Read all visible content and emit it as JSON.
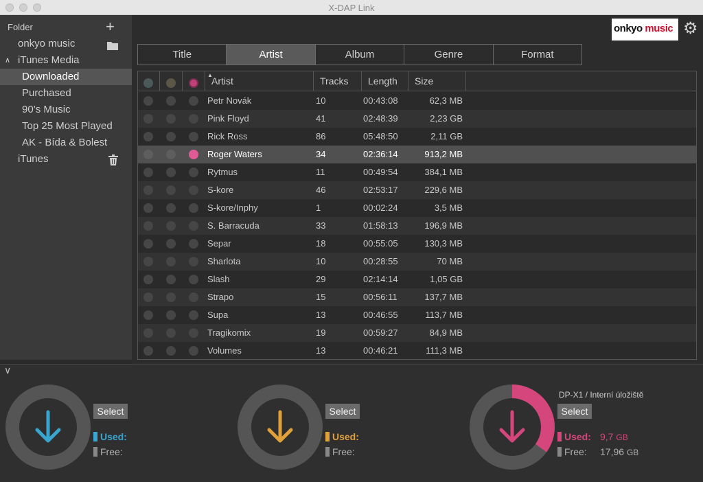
{
  "window": {
    "title": "X-DAP Link"
  },
  "sidebar": {
    "header": "Folder",
    "items": [
      {
        "label": "onkyo music",
        "icon": "folder-icon"
      },
      {
        "label": "iTunes Media"
      },
      {
        "label": "Downloaded",
        "selected": true
      },
      {
        "label": "Purchased"
      },
      {
        "label": "90’s Music"
      },
      {
        "label": "Top 25 Most Played"
      },
      {
        "label": "AK - Bída & Bolest"
      },
      {
        "label": "iTunes",
        "icon": "trash-icon"
      }
    ]
  },
  "logo": {
    "part1": "onkyo",
    "part2": "music"
  },
  "tabs": [
    "Title",
    "Artist",
    "Album",
    "Genre",
    "Format"
  ],
  "active_tab": "Artist",
  "table": {
    "columns": [
      "Artist",
      "Tracks",
      "Length",
      "Size"
    ],
    "header_dot_colors": [
      "#4b5a58",
      "#5c5647",
      "#c0417a"
    ],
    "rows": [
      {
        "artist": "Petr Novák",
        "tracks": "10",
        "length": "00:43:08",
        "size": "62,3 MB"
      },
      {
        "artist": "Pink Floyd",
        "tracks": "41",
        "length": "02:48:39",
        "size": "2,23 GB"
      },
      {
        "artist": "Rick Ross",
        "tracks": "86",
        "length": "05:48:50",
        "size": "2,11 GB"
      },
      {
        "artist": "Roger Waters",
        "tracks": "34",
        "length": "02:36:14",
        "size": "913,2 MB",
        "selected": true
      },
      {
        "artist": "Rytmus",
        "tracks": "11",
        "length": "00:49:54",
        "size": "384,1 MB"
      },
      {
        "artist": "S-kore",
        "tracks": "46",
        "length": "02:53:17",
        "size": "229,6 MB"
      },
      {
        "artist": "S-kore/Inphy",
        "tracks": "1",
        "length": "00:02:24",
        "size": "3,5 MB"
      },
      {
        "artist": "S. Barracuda",
        "tracks": "33",
        "length": "01:58:13",
        "size": "196,9 MB"
      },
      {
        "artist": "Separ",
        "tracks": "18",
        "length": "00:55:05",
        "size": "130,3 MB"
      },
      {
        "artist": "Sharlota",
        "tracks": "10",
        "length": "00:28:55",
        "size": "70 MB"
      },
      {
        "artist": "Slash",
        "tracks": "29",
        "length": "02:14:14",
        "size": "1,05 GB"
      },
      {
        "artist": "Strapo",
        "tracks": "15",
        "length": "00:56:11",
        "size": "137,7 MB"
      },
      {
        "artist": "Supa",
        "tracks": "13",
        "length": "00:46:55",
        "size": "113,7 MB"
      },
      {
        "artist": "Tragikomix",
        "tracks": "19",
        "length": "00:59:27",
        "size": "84,9 MB"
      },
      {
        "artist": "Volumes",
        "tracks": "13",
        "length": "00:46:21",
        "size": "111,3 MB"
      }
    ]
  },
  "devices": [
    {
      "color": "#38a6cf",
      "select_label": "Select",
      "used_label": "Used:",
      "free_label": "Free:",
      "name": "",
      "used_value": "",
      "used_unit": "",
      "free_value": "",
      "free_unit": "",
      "used_fraction": 0
    },
    {
      "color": "#e0a03a",
      "select_label": "Select",
      "used_label": "Used:",
      "free_label": "Free:",
      "name": "",
      "used_value": "",
      "used_unit": "",
      "free_value": "",
      "free_unit": "",
      "used_fraction": 0
    },
    {
      "color": "#d4467c",
      "select_label": "Select",
      "used_label": "Used:",
      "free_label": "Free:",
      "name": "DP-X1 / Interní úložiště",
      "used_value": "9,7",
      "used_unit": "GB",
      "free_value": "17,96",
      "free_unit": "GB",
      "used_fraction": 0.35
    }
  ]
}
